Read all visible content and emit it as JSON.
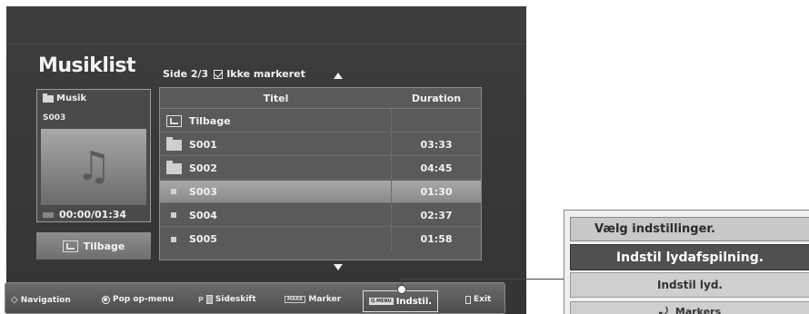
{
  "header": {
    "title": "Musiklist",
    "page_info": "Side 2/3",
    "mark_status": "Ikke markeret"
  },
  "left_panel": {
    "folder": "Musik",
    "current_file": "S003",
    "time": "00:00/01:34",
    "progress": 0.0,
    "back_label": "Tilbage"
  },
  "table": {
    "col_title": "Titel",
    "col_duration": "Duration",
    "rows": [
      {
        "icon": "back-icon",
        "name": "Tilbage",
        "duration": ""
      },
      {
        "icon": "folder-icon",
        "name": "S001",
        "duration": "03:33"
      },
      {
        "icon": "folder-icon",
        "name": "S002",
        "duration": "04:45"
      },
      {
        "icon": "file-icon",
        "name": "S003",
        "duration": "01:30",
        "selected": true
      },
      {
        "icon": "file-icon",
        "name": "S004",
        "duration": "02:37"
      },
      {
        "icon": "file-icon",
        "name": "S005",
        "duration": "01:58"
      }
    ]
  },
  "bottom_bar": {
    "navigation": "Navigation",
    "popup": "Pop op-menu",
    "page_key": "P",
    "pageshift": "Sideskift",
    "mark_key": "MARK",
    "marker": "Marker",
    "qmenu_key": "Q.MENU",
    "indstil": "Indstil.",
    "exit": "Exit"
  },
  "options_menu": {
    "title": "Vælg indstillinger.",
    "item_playback": "Indstil lydafspilning.",
    "item_sound": "Indstil lyd.",
    "item_markers": "Markers"
  },
  "colors": {
    "selected_row": "#9a9a9a",
    "menu_highlight": "#505050"
  }
}
